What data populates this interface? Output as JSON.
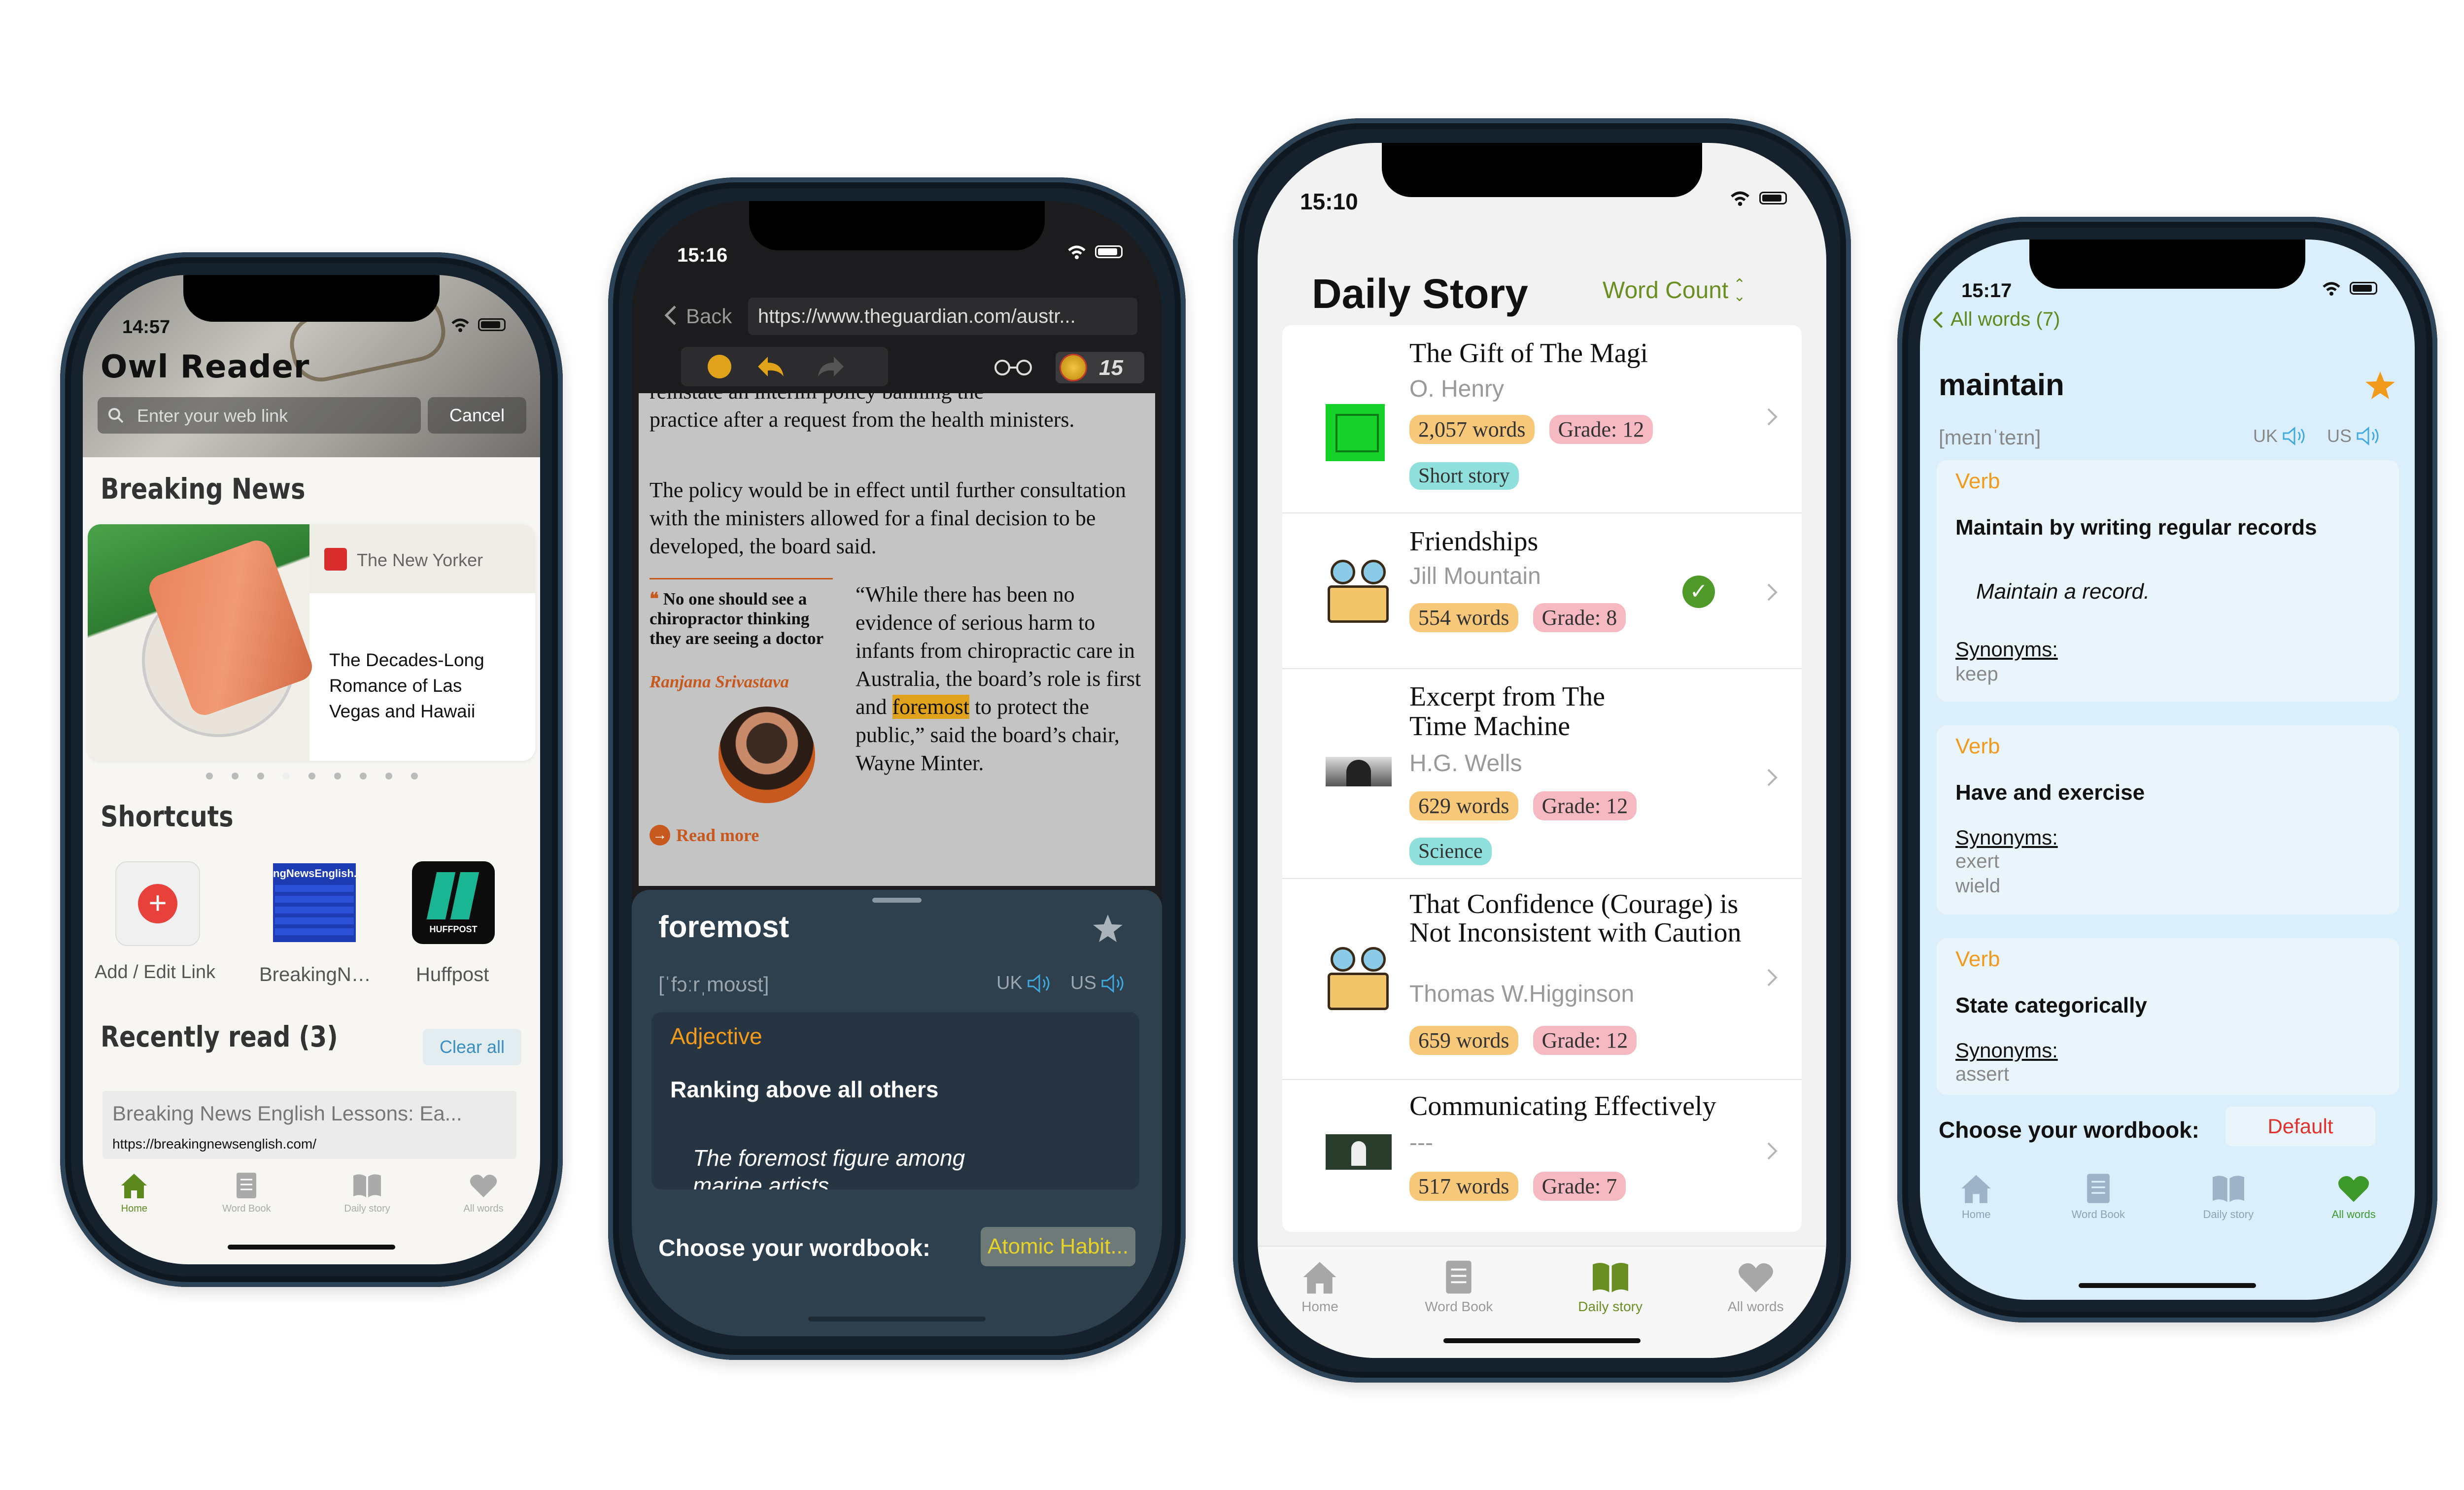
{
  "phone1": {
    "time": "14:57",
    "app_title": "Owl Reader",
    "search_placeholder": "Enter your web link",
    "cancel_label": "Cancel",
    "breaking_news_heading": "Breaking News",
    "news_source": "The New Yorker",
    "news_headline": "The Decades-Long Romance of Las Vegas and Hawaii",
    "shortcuts_heading": "Shortcuts",
    "shortcuts": [
      {
        "label": "Add / Edit Link"
      },
      {
        "label": "BreakingN…",
        "thumb_text": "ngNewsEnglish.c"
      },
      {
        "label": "Huffpost",
        "thumb_text": "HUFFPOST"
      }
    ],
    "recently_read_heading": "Recently read (3)",
    "clear_all_label": "Clear all",
    "recent_title": "Breaking News English Lessons: Ea...",
    "recent_url": "https://breakingnewsenglish.com/",
    "tabs": [
      "Home",
      "Word Book",
      "Daily story",
      "All words"
    ]
  },
  "phone2": {
    "time": "15:16",
    "back_label": "Back",
    "url": "https://www.theguardian.com/austr...",
    "badge_count": "15",
    "article_para1_cut": "reinstate an interim policy banning the",
    "article_para1": "practice after a request from the health ministers.",
    "article_para2": "The policy would be in effect until further consultation with the ministers allowed for a final decision to be developed, the board said.",
    "pullquote": "No one should see a chiropractor thinking they are seeing a doctor",
    "pullquote_author": "Ranjana Srivastava",
    "read_more": "Read more",
    "quote_before": "“While there has been no evidence of serious harm to infants from chiropractic care in Australia, the board’s role is first and ",
    "quote_highlight": "foremost",
    "quote_after": " to protect the public,” said the board’s chair, Wayne Minter.",
    "word": "foremost",
    "phonetic": "[ˈfɔːrˌmoʊst]",
    "uk_label": "UK",
    "us_label": "US",
    "pos": "Adjective",
    "definition": "Ranking above all others",
    "example": "The foremost figure among marine artists",
    "wordbook_label": "Choose your wordbook:",
    "wordbook_value": "Atomic Habit..."
  },
  "phone3": {
    "time": "15:10",
    "title": "Daily Story",
    "sort_label": "Word Count",
    "stories": [
      {
        "title": "The Gift of The Magi",
        "author": "O. Henry",
        "words": "2,057 words",
        "grade": "Grade: 12",
        "tag": "Short story"
      },
      {
        "title": "Friendships",
        "author": "Jill Mountain",
        "words": "554 words",
        "grade": "Grade: 8"
      },
      {
        "title": "Excerpt from The Time Machine",
        "author": "H.G. Wells",
        "words": "629 words",
        "grade": "Grade: 12",
        "tag": "Science"
      },
      {
        "title": "That Confidence (Courage) is Not Inconsistent with Caution",
        "author": "Thomas W.Higginson",
        "words": "659 words",
        "grade": "Grade: 12"
      },
      {
        "title": "Communicating Effectively",
        "author": "---",
        "words": "517 words",
        "grade": "Grade: 7"
      }
    ],
    "tabs": [
      "Home",
      "Word Book",
      "Daily story",
      "All words"
    ]
  },
  "phone4": {
    "time": "15:17",
    "back_label": "All words (7)",
    "word": "maintain",
    "phonetic": "[meɪnˈteɪn]",
    "uk_label": "UK",
    "us_label": "US",
    "senses": [
      {
        "pos": "Verb",
        "definition": "Maintain by writing regular records",
        "example": "Maintain a record.",
        "synonyms_label": "Synonyms:",
        "synonyms": [
          "keep"
        ]
      },
      {
        "pos": "Verb",
        "definition": "Have and exercise",
        "synonyms_label": "Synonyms:",
        "synonyms": [
          "exert",
          "wield"
        ]
      },
      {
        "pos": "Verb",
        "definition": "State categorically",
        "synonyms_label": "Synonyms:",
        "synonyms": [
          "assert"
        ]
      }
    ],
    "wordbook_label": "Choose your wordbook:",
    "wordbook_value": "Default",
    "tabs": [
      "Home",
      "Word Book",
      "Daily story",
      "All words"
    ]
  },
  "colors": {
    "accent_green": "#5c8a1e",
    "orange": "#f29a1b",
    "highlight": "#e0a21a",
    "pill_orange": "#f7c87a",
    "pill_pink": "#f6b9c1",
    "pill_teal": "#8fe0dc",
    "dict_light_bg": "#dbeefb",
    "dict_dark_bg": "#2e3f4d"
  }
}
